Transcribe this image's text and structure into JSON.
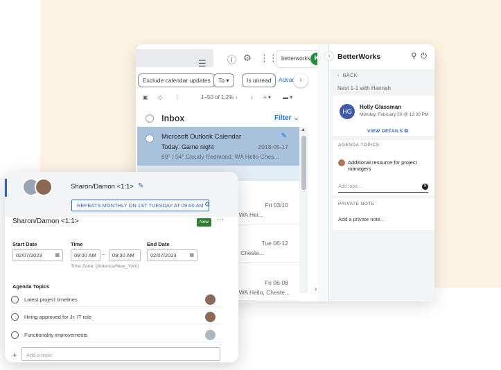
{
  "gmail": {
    "brand_label": "betterworks",
    "account_initial": "K",
    "chips": [
      "Exclude calendar updates",
      "To ▾",
      "Is unread"
    ],
    "advanced_search": "Advan",
    "pagination": "1–50 of 1,2%",
    "inbox_label": "Inbox",
    "filter_label": "Filter ⌄",
    "highlighted_email": {
      "subject": "Microsoft Outlook Calendar",
      "line2": "Today: Game night",
      "date": "2018-05-17",
      "preview": "69° / 54° Cloudy Redmond, WA Hello Ches..."
    },
    "emails": [
      {
        "sender": "r",
        "date": "Fri 03/10",
        "preview": "dmond, WA Hel..."
      },
      {
        "sender": "",
        "date": "Tue 06-12",
        "preview": "s, Hello, Cheste..."
      },
      {
        "sender": "r",
        "date": "Fri 06-08",
        "preview": "dmond, WA Hello, Cheste..."
      }
    ]
  },
  "betterworks": {
    "title": "BetterWorks",
    "back_label": "BACK",
    "next_meeting": "Next 1-1 with Hannah",
    "person": {
      "initials": "HG",
      "name": "Holly Glassman",
      "datetime": "Monday, February 20 @ 12:30 PM"
    },
    "view_details": "VIEW DETAILS",
    "agenda_topics_label": "AGENDA TOPICS",
    "agenda_item": "Additional resource for project managers",
    "add_topic_placeholder": "Add topic...",
    "private_note_label": "PRIVATE NOTE",
    "private_note_placeholder": "Add a private note..."
  },
  "meeting": {
    "header_name": "Sharon/Damon <1:1>",
    "repeat_label": "REPEATS MONTHLY ON 1ST TUESDAY AT 09:00 AM",
    "title": "Sharon/Damon <1:1>",
    "badge": "New",
    "start_date_label": "Start Date",
    "start_date": "02/07/2023",
    "time_label": "Time",
    "time_start": "09:00 AM",
    "time_end": "09:30 AM",
    "end_date_label": "End Date",
    "end_date": "02/07/2023",
    "timezone": "Time Zone: (America/New_York)",
    "agenda_label": "Agenda Topics",
    "agenda_topics": [
      "Latest project timelines",
      "Hiring approved for Jr. IT role",
      "Functionality improvements"
    ],
    "add_topic_placeholder": "Add a topic"
  },
  "colors": {
    "accent_blue": "#2f62c6",
    "highlight_row": "#a8c2dc",
    "badge_green": "#2e7d32",
    "background_panel": "#fdf3e3"
  }
}
